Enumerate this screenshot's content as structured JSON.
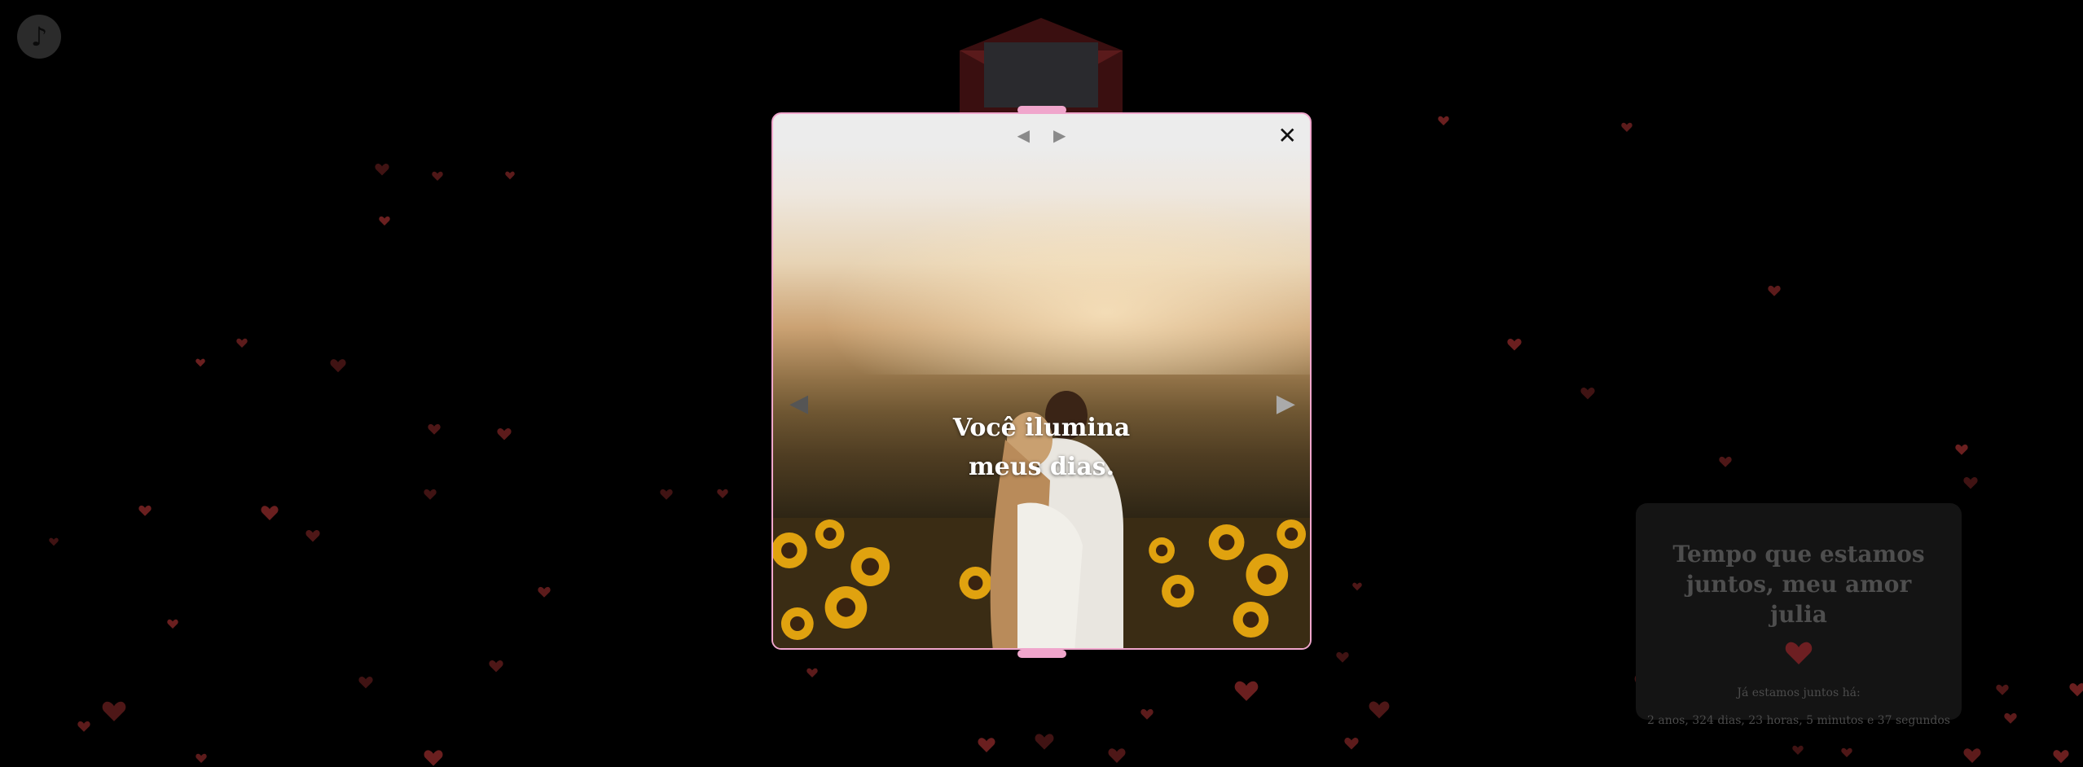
{
  "music_button": {
    "icon": "music-note-icon",
    "glyph": "♪"
  },
  "modal": {
    "caption_line1": "Você ilumina",
    "caption_line2": "meus dias.",
    "nav_prev": "◀",
    "nav_next": "▶",
    "slide_prev": "◀",
    "slide_next": "▶",
    "close": "✕",
    "image": "couple-in-sunflower-field"
  },
  "counter": {
    "title": "Tempo que estamos juntos, meu amor julia",
    "since_label": "Já estamos juntos há:",
    "elapsed": "2 anos, 324 dias, 23 horas, 5 minutos e 37 segundos"
  },
  "colors": {
    "background": "#000000",
    "accent_pink": "#f0a6cc",
    "heart_red": "#8e2a2a",
    "card_bg": "#141414"
  }
}
